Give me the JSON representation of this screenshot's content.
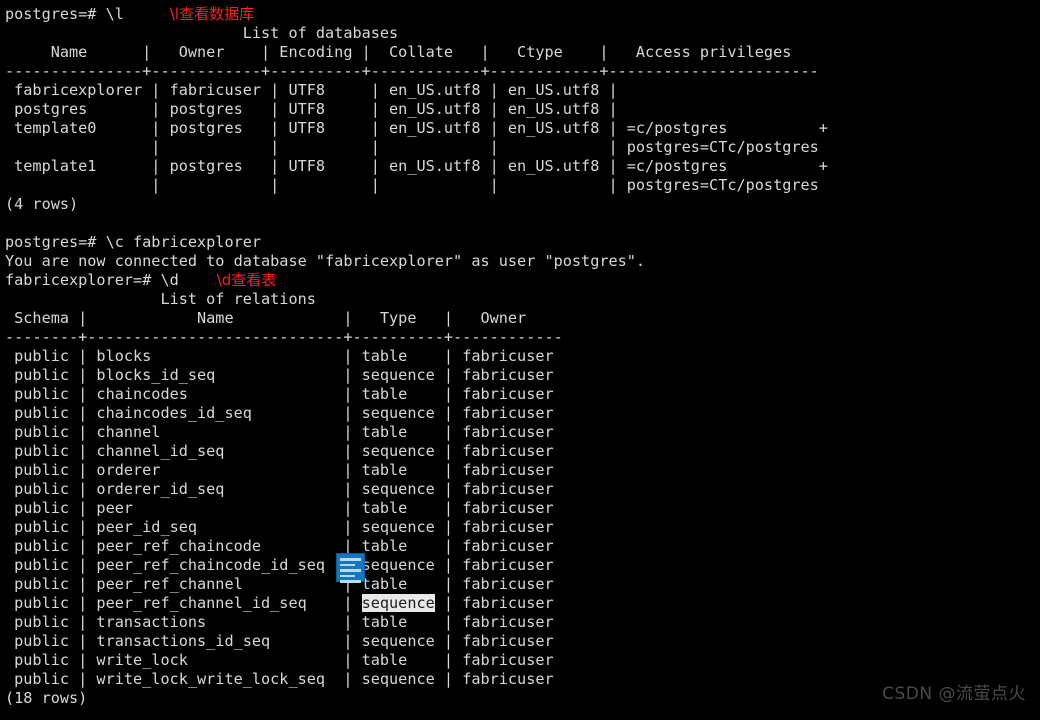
{
  "terminal": {
    "colors": {
      "background": "#000000",
      "foreground": "#d8d8d8",
      "annotation": "#ff1c1c",
      "highlight_bg": "#e9e9e9",
      "highlight_fg": "#1a1a1a",
      "watermark": "#4a4a4a",
      "icon_blue": "#1277be"
    }
  },
  "session": {
    "prompt_1": "postgres=# \\l",
    "annotation_1": "\\l查看数据库",
    "databases": {
      "title": "                          List of databases",
      "header": "     Name      |   Owner    | Encoding |  Collate   |   Ctype    |   Access privileges",
      "separator": "---------------+------------+----------+------------+------------+-----------------------",
      "rows": [
        " fabricexplorer | fabricuser | UTF8     | en_US.utf8 | en_US.utf8 |",
        " postgres       | postgres   | UTF8     | en_US.utf8 | en_US.utf8 |",
        " template0      | postgres   | UTF8     | en_US.utf8 | en_US.utf8 | =c/postgres          +",
        "                |            |          |            |            | postgres=CTc/postgres",
        " template1      | postgres   | UTF8     | en_US.utf8 | en_US.utf8 | =c/postgres          +",
        "                |            |          |            |            | postgres=CTc/postgres"
      ],
      "row_count": "(4 rows)"
    },
    "prompt_2": "postgres=# \\c fabricexplorer",
    "connect_message": "You are now connected to database \"fabricexplorer\" as user \"postgres\".",
    "prompt_3": "fabricexplorer=# \\d",
    "annotation_2": "\\d查看表",
    "relations": {
      "title": "                 List of relations",
      "header": " Schema |            Name            |   Type   |   Owner",
      "separator": "--------+----------------------------+----------+------------",
      "rows": [
        {
          "schema": "public",
          "name": "blocks",
          "type": "table",
          "owner": "fabricuser",
          "highlighted": false
        },
        {
          "schema": "public",
          "name": "blocks_id_seq",
          "type": "sequence",
          "owner": "fabricuser",
          "highlighted": false
        },
        {
          "schema": "public",
          "name": "chaincodes",
          "type": "table",
          "owner": "fabricuser",
          "highlighted": false
        },
        {
          "schema": "public",
          "name": "chaincodes_id_seq",
          "type": "sequence",
          "owner": "fabricuser",
          "highlighted": false
        },
        {
          "schema": "public",
          "name": "channel",
          "type": "table",
          "owner": "fabricuser",
          "highlighted": false
        },
        {
          "schema": "public",
          "name": "channel_id_seq",
          "type": "sequence",
          "owner": "fabricuser",
          "highlighted": false
        },
        {
          "schema": "public",
          "name": "orderer",
          "type": "table",
          "owner": "fabricuser",
          "highlighted": false
        },
        {
          "schema": "public",
          "name": "orderer_id_seq",
          "type": "sequence",
          "owner": "fabricuser",
          "highlighted": false
        },
        {
          "schema": "public",
          "name": "peer",
          "type": "table",
          "owner": "fabricuser",
          "highlighted": false
        },
        {
          "schema": "public",
          "name": "peer_id_seq",
          "type": "sequence",
          "owner": "fabricuser",
          "highlighted": false
        },
        {
          "schema": "public",
          "name": "peer_ref_chaincode",
          "type": "table",
          "owner": "fabricuser",
          "highlighted": false
        },
        {
          "schema": "public",
          "name": "peer_ref_chaincode_id_seq",
          "type": "sequence",
          "owner": "fabricuser",
          "highlighted": false
        },
        {
          "schema": "public",
          "name": "peer_ref_channel",
          "type": "table",
          "owner": "fabricuser",
          "highlighted": false
        },
        {
          "schema": "public",
          "name": "peer_ref_channel_id_seq",
          "type": "sequence",
          "owner": "fabricuser",
          "highlighted": true
        },
        {
          "schema": "public",
          "name": "transactions",
          "type": "table",
          "owner": "fabricuser",
          "highlighted": false
        },
        {
          "schema": "public",
          "name": "transactions_id_seq",
          "type": "sequence",
          "owner": "fabricuser",
          "highlighted": false
        },
        {
          "schema": "public",
          "name": "write_lock",
          "type": "table",
          "owner": "fabricuser",
          "highlighted": false
        },
        {
          "schema": "public",
          "name": "write_lock_write_lock_seq",
          "type": "sequence",
          "owner": "fabricuser",
          "highlighted": false
        }
      ],
      "row_count": "(18 rows)"
    }
  },
  "watermark": "CSDN @流萤点火",
  "overlay_icon": "document-text-icon"
}
